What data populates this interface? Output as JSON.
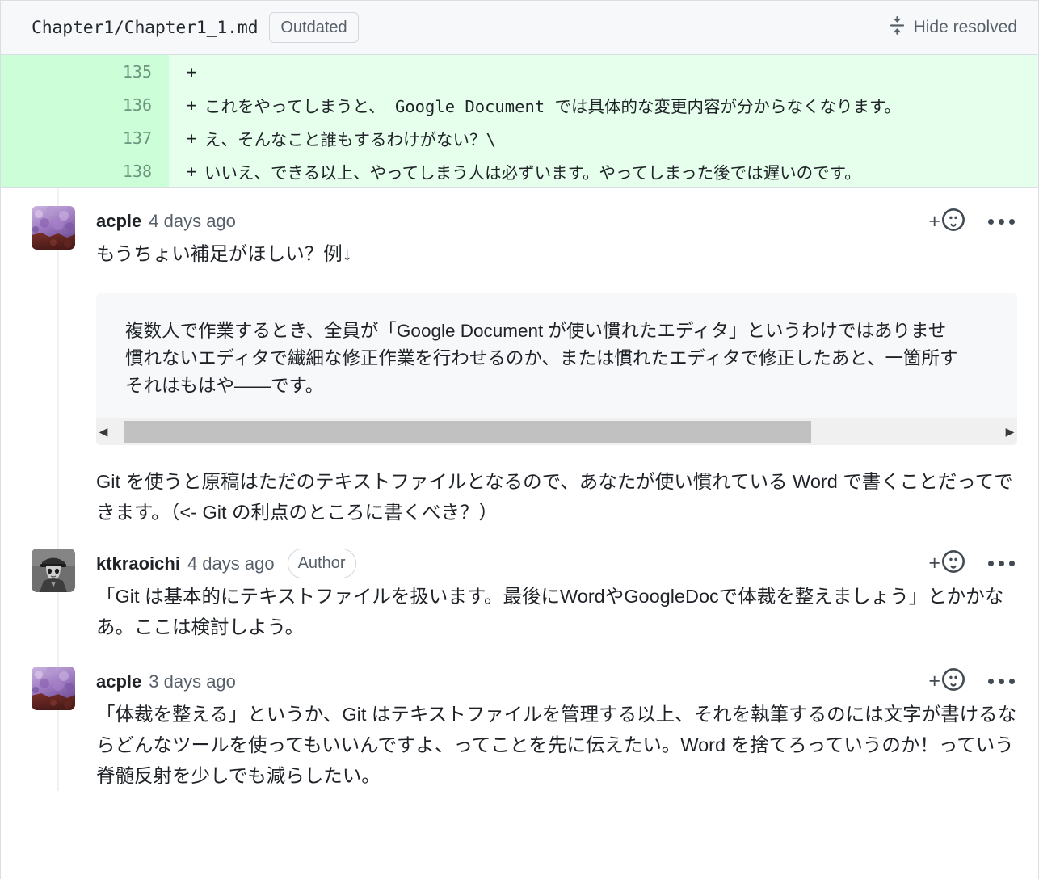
{
  "file_header": {
    "path": "Chapter1/Chapter1_1.md",
    "outdated_badge": "Outdated",
    "hide_resolved_label": "Hide resolved",
    "fold_icon": "fold-icon"
  },
  "diff": {
    "lines": [
      {
        "number": "135",
        "marker": "+",
        "code": ""
      },
      {
        "number": "136",
        "marker": "+",
        "code": "これをやってしまうと、 Google Document では具体的な変更内容が分からなくなります。"
      },
      {
        "number": "137",
        "marker": "+",
        "code": "え、そんなこと誰もするわけがない？\\"
      },
      {
        "number": "138",
        "marker": "+",
        "code": "いいえ、できる以上、やってしまう人は必ずいます。やってしまった後では遅いのです。"
      }
    ],
    "colors": {
      "gutter_bg": "#ccffd8",
      "code_bg": "#e6ffec"
    }
  },
  "comments": [
    {
      "author": "acple",
      "timestamp": "4 days ago",
      "badge": null,
      "avatar_name": "avatar-acple",
      "body_intro": "もうちょい補足がほしい？例↓",
      "codeblock": {
        "lines": [
          "複数人で作業するとき、全員が「Google Document  が使い慣れたエディタ」というわけではありませ",
          "慣れないエディタで繊細な修正作業を行わせるのか、または慣れたエディタで修正したあと、一箇所す",
          "それはもはや――です。"
        ],
        "scroll_left_arrow": "◀",
        "scroll_right_arrow": "▶"
      },
      "body_outro": "Git を使うと原稿はただのテキストファイルとなるので、あなたが使い慣れている Word で書くことだってできます。（<- Git の利点のところに書くべき？）",
      "actions": {
        "add_reaction": "+",
        "reaction_icon": "smiley-icon",
        "menu_icon": "kebab-menu-icon"
      }
    },
    {
      "author": "ktkraoichi",
      "timestamp": "4 days ago",
      "badge": "Author",
      "avatar_name": "avatar-ktkraoichi",
      "body": "「Git は基本的にテキストファイルを扱います。最後にWordやGoogleDocで体裁を整えましょう」とかかなあ。ここは検討しよう。",
      "actions": {
        "add_reaction": "+",
        "reaction_icon": "smiley-icon",
        "menu_icon": "kebab-menu-icon"
      }
    },
    {
      "author": "acple",
      "timestamp": "3 days ago",
      "badge": null,
      "avatar_name": "avatar-acple",
      "body": "「体裁を整える」というか、Git はテキストファイルを管理する以上、それを執筆するのには文字が書けるならどんなツールを使ってもいいんですよ、ってことを先に伝えたい。Word を捨てろっていうのか！っていう脊髄反射を少しでも減らしたい。",
      "actions": {
        "add_reaction": "+",
        "reaction_icon": "smiley-icon",
        "menu_icon": "kebab-menu-icon"
      }
    }
  ]
}
